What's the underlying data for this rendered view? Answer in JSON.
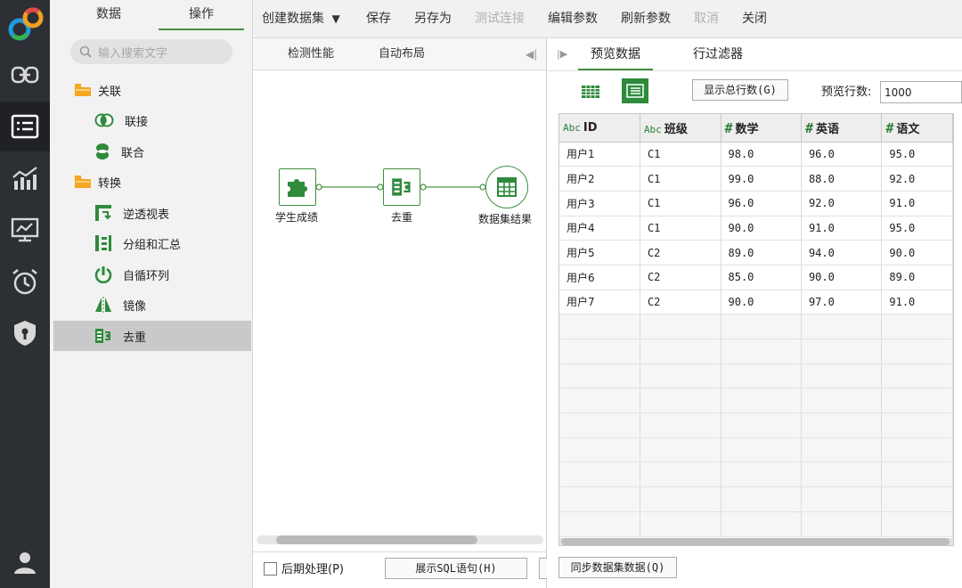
{
  "panel": {
    "tabs": [
      {
        "label": "数据"
      },
      {
        "label": "操作"
      }
    ],
    "search_placeholder": "输入搜索文字",
    "groups": [
      {
        "label": "关联",
        "items": [
          {
            "label": "联接"
          },
          {
            "label": "联合"
          }
        ]
      },
      {
        "label": "转换",
        "items": [
          {
            "label": "逆透视表"
          },
          {
            "label": "分组和汇总"
          },
          {
            "label": "自循环列"
          },
          {
            "label": "镜像"
          },
          {
            "label": "去重"
          }
        ]
      }
    ]
  },
  "toolbar": {
    "create_dataset": "创建数据集",
    "save": "保存",
    "save_as": "另存为",
    "test_connection": "测试连接",
    "edit_params": "编辑参数",
    "refresh_params": "刷新参数",
    "cancel": "取消",
    "close": "关闭"
  },
  "canvas": {
    "detect_performance": "检测性能",
    "auto_layout": "自动布局",
    "nodes": [
      {
        "label": "学生成绩"
      },
      {
        "label": "去重"
      },
      {
        "label": "数据集结果"
      }
    ],
    "post_process": "后期处理(P)",
    "show_sql": "展示SQL语句(H)"
  },
  "preview": {
    "tabs": [
      {
        "label": "预览数据"
      },
      {
        "label": "行过滤器"
      }
    ],
    "show_total_rows": "显示总行数(G)",
    "preview_rows_label": "预览行数:",
    "preview_rows_value": "1000",
    "sync_button": "同步数据集数据(Q)",
    "columns": [
      {
        "type": "Abc",
        "name": "ID"
      },
      {
        "type": "Abc",
        "name": "班级"
      },
      {
        "type": "#",
        "name": "数学"
      },
      {
        "type": "#",
        "name": "英语"
      },
      {
        "type": "#",
        "name": "语文"
      }
    ],
    "rows": [
      [
        "用户1",
        "C1",
        "98.0",
        "96.0",
        "95.0"
      ],
      [
        "用户2",
        "C1",
        "99.0",
        "88.0",
        "92.0"
      ],
      [
        "用户3",
        "C1",
        "96.0",
        "92.0",
        "91.0"
      ],
      [
        "用户4",
        "C1",
        "90.0",
        "91.0",
        "95.0"
      ],
      [
        "用户5",
        "C2",
        "89.0",
        "94.0",
        "90.0"
      ],
      [
        "用户6",
        "C2",
        "85.0",
        "90.0",
        "89.0"
      ],
      [
        "用户7",
        "C2",
        "90.0",
        "97.0",
        "91.0"
      ]
    ]
  },
  "colors": {
    "accent": "#3f8f3f",
    "rail_bg": "#2c2f33",
    "folder": "#f5a623"
  }
}
